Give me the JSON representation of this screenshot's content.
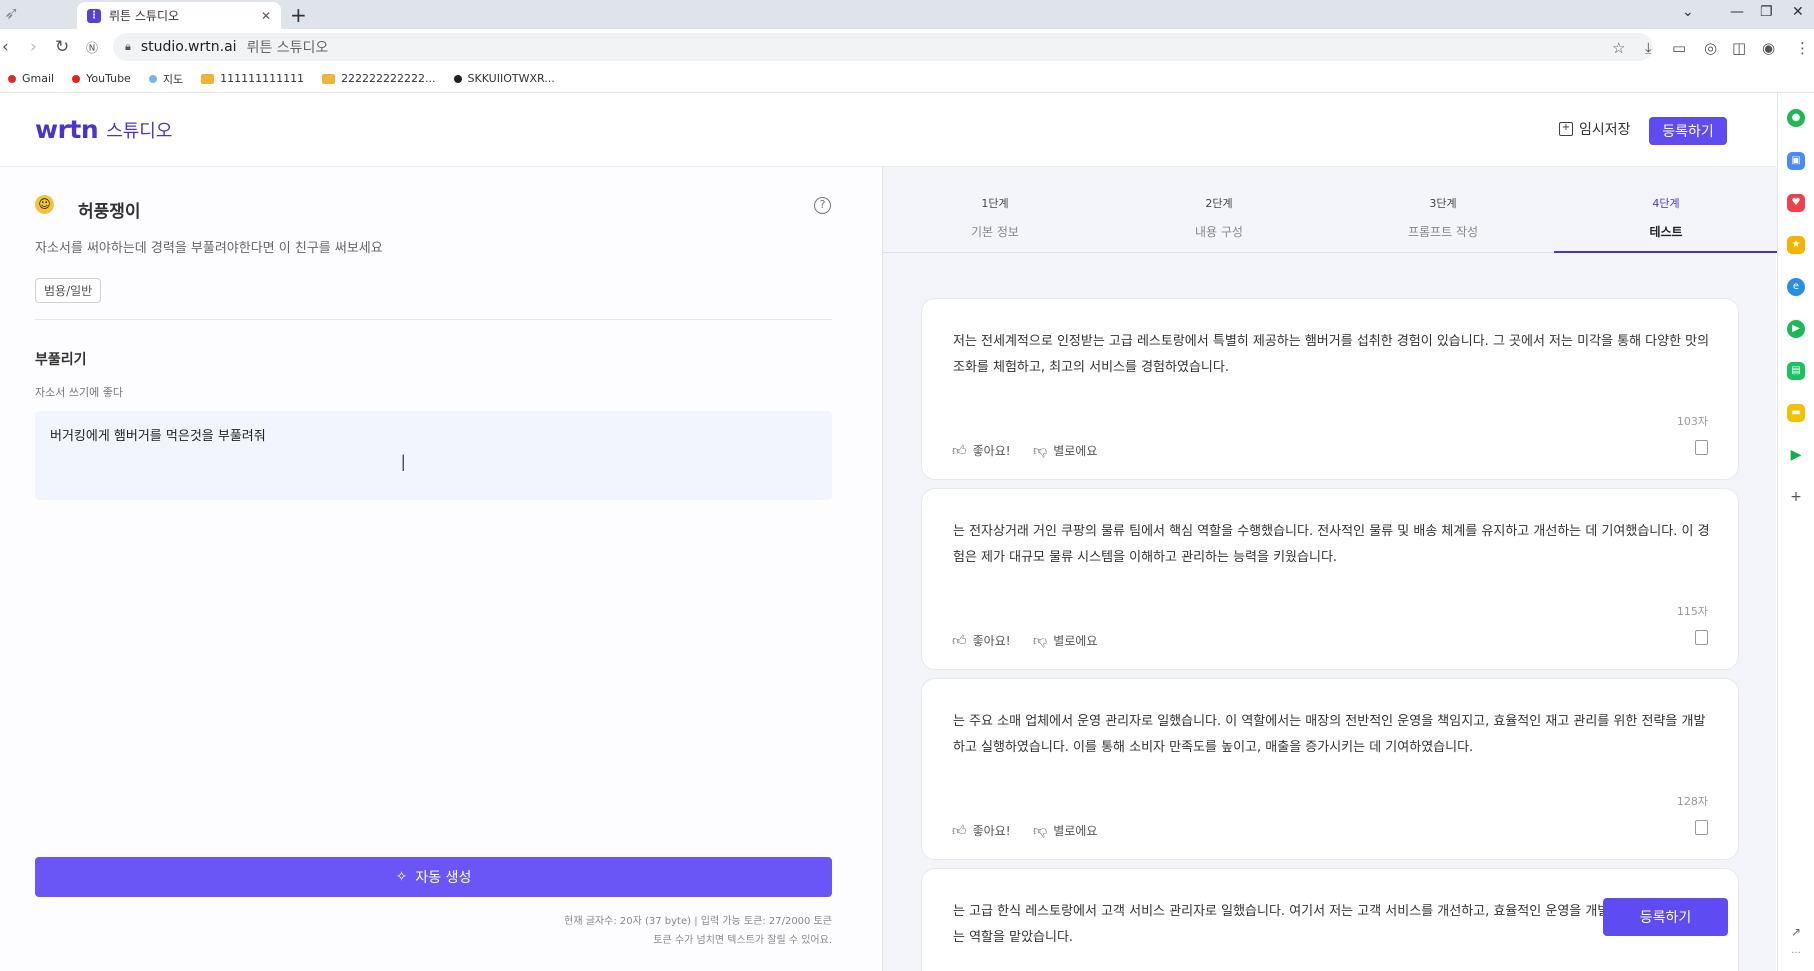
{
  "browser": {
    "tab_title": "뤼튼 스튜디오",
    "url_host": "studio.wrtn.ai",
    "url_page_title": "뤼튼 스튜디오",
    "bookmarks": [
      {
        "label": "Gmail",
        "color": "#d93025",
        "kind": "dot"
      },
      {
        "label": "YouTube",
        "color": "#e62117",
        "kind": "dot"
      },
      {
        "label": "지도",
        "color": "#7bb3f0",
        "kind": "dot"
      },
      {
        "label": "111111111111",
        "color": "#f0b43a",
        "kind": "folder"
      },
      {
        "label": "222222222222...",
        "color": "#f0b43a",
        "kind": "folder"
      },
      {
        "label": "SKKUIIOTWXR...",
        "color": "#222222",
        "kind": "dot"
      }
    ]
  },
  "header": {
    "logo_mark": "wrtn",
    "logo_suffix": "스튜디오",
    "temp_save_label": "임시저장",
    "register_label": "등록하기"
  },
  "left": {
    "bot_name": "허풍쟁이",
    "bot_description": "자소서를 써야하는데 경력을 부풀려야한다면 이 친구를 써보세요",
    "category": "범용/일반",
    "field_label": "부풀리기",
    "field_hint": "자소서 쓰기에 좋다",
    "input_value": "버거킹에게 햄버거를 먹은것을 부풀려줘",
    "auto_generate_label": "자동 생성",
    "count_line1": "현재 글자수: 20자 (37 byte)  |  입력 가능 토큰: 27/2000 토큰",
    "count_line2": "토큰 수가 넘치면 텍스트가 잘릴 수 있어요."
  },
  "steps": [
    {
      "num": "1단계",
      "name": "기본 정보"
    },
    {
      "num": "2단계",
      "name": "내용 구성"
    },
    {
      "num": "3단계",
      "name": "프롬프트 작성"
    },
    {
      "num": "4단계",
      "name": "테스트"
    }
  ],
  "results": [
    {
      "text": "저는 전세계적으로 인정받는 고급 레스토랑에서 특별히 제공하는 햄버거를 섭취한 경험이 있습니다. 그 곳에서 저는 미각을 통해 다양한 맛의 조화를 체험하고, 최고의 서비스를 경험하였습니다.",
      "chars": "103자"
    },
    {
      "text": "는 전자상거래 거인 쿠팡의 물류 팀에서 핵심 역할을 수행했습니다. 전사적인 물류 및 배송 체계를 유지하고 개선하는 데 기여했습니다. 이 경험은 제가 대규모 물류 시스템을 이해하고 관리하는 능력을 키웠습니다.",
      "chars": "115자"
    },
    {
      "text": "는 주요 소매 업체에서 운영 관리자로 일했습니다. 이 역할에서는 매장의 전반적인 운영을 책임지고, 효율적인 재고 관리를 위한 전략을 개발하고 실행하였습니다. 이를 통해 소비자 만족도를 높이고, 매출을 증가시키는 데 기여하였습니다.",
      "chars": "128자"
    },
    {
      "text": "는 고급 한식 레스토랑에서 고객 서비스 관리자로 일했습니다. 여기서 저는 고객 서비스를 개선하고, 효율적인 운영을 개발하는 역할을 맡았습니다.",
      "chars": ""
    }
  ],
  "card_actions": {
    "like": "좋아요!",
    "dislike": "별로에요"
  },
  "float_register_label": "등록하기",
  "colors": {
    "accent": "#5f4bf2",
    "brand": "#4b35c9"
  }
}
